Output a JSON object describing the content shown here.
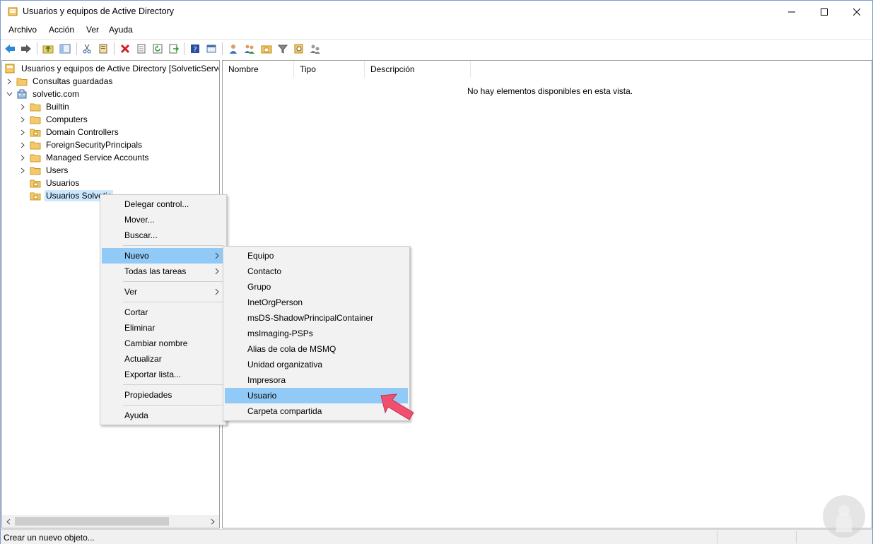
{
  "window": {
    "title": "Usuarios y equipos de Active Directory"
  },
  "menubar": {
    "items": [
      "Archivo",
      "Acción",
      "Ver",
      "Ayuda"
    ]
  },
  "tree": {
    "root": "Usuarios y equipos de Active Directory [SolveticServer]",
    "saved_queries": "Consultas guardadas",
    "domain": "solvetic.com",
    "children": [
      "Builtin",
      "Computers",
      "Domain Controllers",
      "ForeignSecurityPrincipals",
      "Managed Service Accounts",
      "Users",
      "Usuarios",
      "Usuarios Solvetic"
    ]
  },
  "list": {
    "columns": [
      "Nombre",
      "Tipo",
      "Descripción"
    ],
    "empty_message": "No hay elementos disponibles en esta vista."
  },
  "context_menu": {
    "items": [
      "Delegar control...",
      "Mover...",
      "Buscar...",
      "Nuevo",
      "Todas las tareas",
      "Ver",
      "Cortar",
      "Eliminar",
      "Cambiar nombre",
      "Actualizar",
      "Exportar lista...",
      "Propiedades",
      "Ayuda"
    ]
  },
  "submenu_nuevo": {
    "items": [
      "Equipo",
      "Contacto",
      "Grupo",
      "InetOrgPerson",
      "msDS-ShadowPrincipalContainer",
      "msImaging-PSPs",
      "Alias de cola de MSMQ",
      "Unidad organizativa",
      "Impresora",
      "Usuario",
      "Carpeta compartida"
    ],
    "highlighted": "Usuario"
  },
  "status": {
    "text": "Crear un nuevo objeto..."
  },
  "colors": {
    "highlight": "#91c9f7",
    "selection": "#cce8ff",
    "arrow": "#f0506e",
    "folder": "#f5c96a"
  }
}
